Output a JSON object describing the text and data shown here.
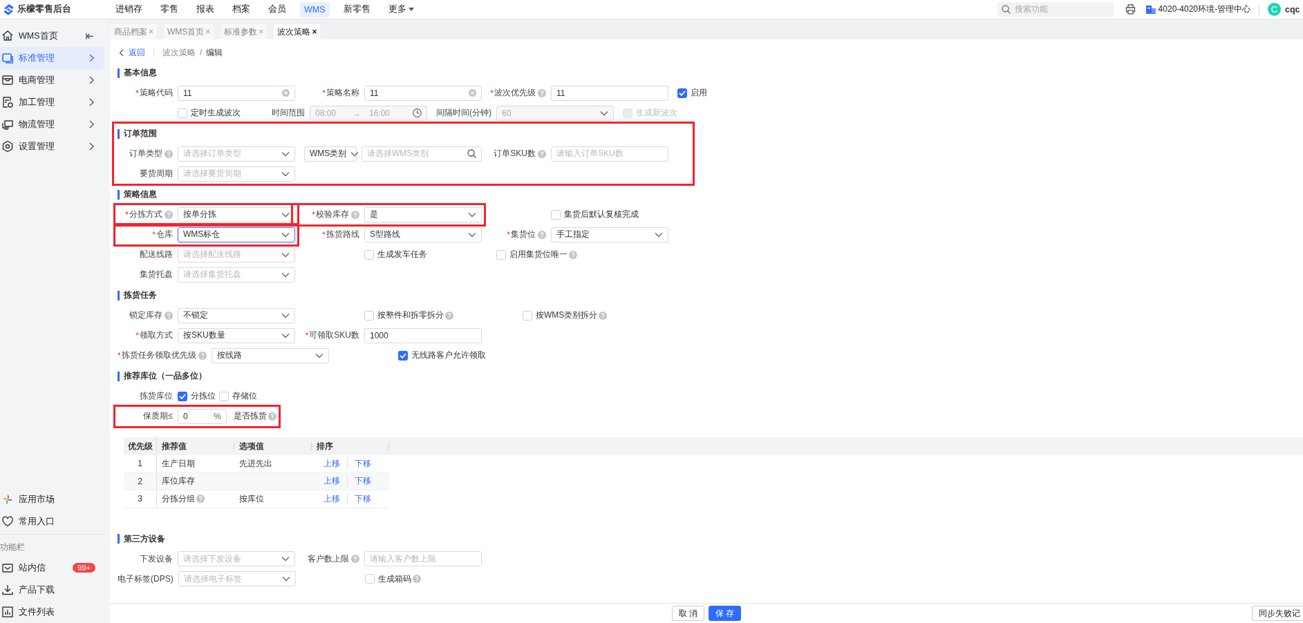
{
  "app": {
    "title": "乐檬零售后台"
  },
  "top_menu": [
    {
      "label": "进销存",
      "selected": false,
      "kind": "link"
    },
    {
      "label": "零售",
      "selected": false,
      "kind": "link"
    },
    {
      "label": "报表",
      "selected": false,
      "kind": "link"
    },
    {
      "label": "档案",
      "selected": false,
      "kind": "link"
    },
    {
      "label": "会员",
      "selected": false,
      "kind": "link"
    },
    {
      "label": "WMS",
      "selected": true,
      "kind": "link"
    },
    {
      "label": "新零售",
      "selected": false,
      "kind": "link"
    },
    {
      "label": "更多",
      "selected": false,
      "kind": "dropdown"
    }
  ],
  "search": {
    "placeholder": "搜索功能"
  },
  "org": "4020-4020环境-管理中心",
  "user": {
    "initial": "C",
    "name": "cqc"
  },
  "sidebar": {
    "items": [
      {
        "label": "WMS首页",
        "selected": false,
        "kind": "collapse"
      },
      {
        "label": "标准管理",
        "selected": true,
        "kind": "submenu"
      },
      {
        "label": "电商管理",
        "selected": false,
        "kind": "submenu"
      },
      {
        "label": "加工管理",
        "selected": false,
        "kind": "submenu"
      },
      {
        "label": "物流管理",
        "selected": false,
        "kind": "submenu"
      },
      {
        "label": "设置管理",
        "selected": false,
        "kind": "submenu"
      }
    ],
    "links": [
      {
        "label": "应用市场"
      },
      {
        "label": "常用入口"
      }
    ],
    "section_title": "功能栏",
    "tools": [
      {
        "label": "站内信",
        "badge": "99+"
      },
      {
        "label": "产品下载"
      },
      {
        "label": "文件列表"
      }
    ]
  },
  "tabs": [
    {
      "label": "商品档案",
      "close": "×",
      "selected": false
    },
    {
      "label": "WMS首页",
      "close": "×",
      "selected": false
    },
    {
      "label": "标准参数",
      "close": "×",
      "selected": false
    },
    {
      "label": "波次策略",
      "close": "×",
      "selected": true
    }
  ],
  "breadcrumb": {
    "back": "返回",
    "path": [
      "波次策略",
      "编辑"
    ],
    "separator": "/"
  },
  "sections": [
    {
      "title": "基本信息",
      "highlighted": false,
      "rows": [
        {
          "items": [
            {
              "kind": "clear_input",
              "star": "*",
              "label": "策略代码",
              "help": false,
              "value": "11"
            },
            {
              "kind": "clear_input",
              "star": "*",
              "label": "策略名称",
              "help": false,
              "value": "11"
            },
            {
              "kind": "input",
              "star": "*",
              "label": "波次优先级",
              "help": true,
              "value": "11"
            },
            {
              "kind": "checkbox",
              "label": "启用",
              "help": false,
              "checked": true
            }
          ]
        },
        {
          "items": [
            {
              "kind": "checkbox",
              "label": "定时生成波次",
              "help": false,
              "checked": false,
              "disabled": false
            },
            {
              "kind": "time_range",
              "label": "时间范围",
              "help": false,
              "start": "08:00",
              "separator": "→",
              "end": "16:00",
              "disabled": true
            },
            {
              "kind": "select",
              "label": "间隔时间(分钟)",
              "help": false,
              "value": "60",
              "disabled": true
            },
            {
              "kind": "checkbox",
              "label": "生成新波次",
              "help": false,
              "checked": false,
              "disabled": true
            }
          ]
        }
      ]
    },
    {
      "title": "订单范围",
      "highlighted": true,
      "rows": [
        {
          "items": [
            {
              "kind": "select",
              "label": "订单类型",
              "help": true,
              "placeholder": "请选择订单类型"
            },
            {
              "kind": "search_select",
              "value": "WMS类别",
              "placeholder": "请选择WMS类别"
            },
            {
              "kind": "input",
              "label": "订单SKU数",
              "help": true,
              "placeholder": "请输入订单SKU数"
            }
          ]
        },
        {
          "items": [
            {
              "kind": "select",
              "label": "要货周期",
              "help": false,
              "placeholder": "请选择要货周期"
            }
          ]
        }
      ]
    },
    {
      "title": "策略信息",
      "highlighted": false,
      "rows": [
        {
          "items": [
            {
              "kind": "select",
              "star": "*",
              "label": "分拣方式",
              "help": true,
              "value": "按单分拣",
              "highlighted": true
            },
            {
              "kind": "select",
              "star": "*",
              "label": "校验库存",
              "help": true,
              "value": "是",
              "highlighted": true
            },
            {
              "kind": "checkbox",
              "label": "集货后默认复核完成",
              "help": false,
              "checked": false,
              "highlighted": false
            }
          ]
        },
        {
          "items": [
            {
              "kind": "select",
              "star": "*",
              "label": "仓库",
              "help": false,
              "value": "WMS标仓",
              "highlighted": true,
              "focused": true
            },
            {
              "kind": "select",
              "star": "*",
              "label": "拣货路线",
              "help": false,
              "value": "S型路线",
              "highlighted": false,
              "focused": false
            },
            {
              "kind": "select",
              "star": "*",
              "label": "集货位",
              "help": true,
              "value": "手工指定",
              "highlighted": false,
              "focused": false
            }
          ]
        },
        {
          "items": [
            {
              "kind": "select",
              "label": "配送线路",
              "help": false,
              "placeholder": "请选择配送线路"
            },
            {
              "kind": "checkbox",
              "label": "生成发车任务",
              "help": false,
              "checked": false
            },
            {
              "kind": "checkbox",
              "label": "启用集货位唯一",
              "help": true,
              "checked": false
            }
          ]
        },
        {
          "items": [
            {
              "kind": "select",
              "label": "集货托盘",
              "help": false,
              "placeholder": "请选择集货托盘"
            }
          ]
        }
      ]
    },
    {
      "title": "拣货任务",
      "highlighted": false,
      "rows": [
        {
          "items": [
            {
              "kind": "select",
              "label": "锁定库存",
              "help": true,
              "value": "不锁定"
            },
            {
              "kind": "checkbox",
              "label": "按整件和拆零拆分",
              "help": true,
              "checked": false
            },
            {
              "kind": "checkbox",
              "label": "按WMS类别拆分",
              "help": true,
              "checked": false
            }
          ]
        },
        {
          "items": [
            {
              "kind": "select",
              "star": "*",
              "label": "领取方式",
              "help": false,
              "value": "按SKU数量"
            },
            {
              "kind": "input",
              "star": "*",
              "label": "可领取SKU数",
              "help": false,
              "value": "1000"
            }
          ]
        },
        {
          "items": [
            {
              "kind": "select",
              "star": "*",
              "label": "拣货任务领取优先级",
              "help": true,
              "value": "按线路"
            },
            {
              "kind": "checkbox",
              "label": "无线路客户允许领取",
              "help": false,
              "checked": true
            }
          ]
        }
      ]
    },
    {
      "title": "推荐库位（一品多位）",
      "highlighted": false,
      "rows": [
        {
          "items": [
            {
              "kind": "check_group",
              "label": "拣货库位",
              "help": false,
              "options": [
                {
                  "label": "分拣位",
                  "checked": true
                },
                {
                  "label": "存储位",
                  "checked": false
                }
              ]
            }
          ]
        },
        {
          "items": [
            {
              "kind": "percent",
              "label": "保质期≤",
              "help": false,
              "value": "0",
              "unit": "%",
              "note": "是否拣货",
              "note_help": true,
              "highlighted": true
            }
          ]
        }
      ],
      "table": {
        "columns": [
          "优先级",
          "推荐值",
          "选项值",
          "排序"
        ],
        "rows": [
          {
            "cells": [
              "1",
              "生产日期",
              "先进先出"
            ],
            "help": false,
            "actions": [
              "上移",
              "下移"
            ]
          },
          {
            "cells": [
              "2",
              "库位库存",
              ""
            ],
            "help": false,
            "actions": [
              "上移",
              "下移"
            ]
          },
          {
            "cells": [
              "3",
              "分拣分组",
              "按库位"
            ],
            "help": true,
            "actions": [
              "上移",
              "下移"
            ]
          }
        ]
      }
    },
    {
      "title": "第三方设备",
      "highlighted": false,
      "rows": [
        {
          "items": [
            {
              "kind": "select",
              "label": "下发设备",
              "help": false,
              "placeholder": "请选择下发设备"
            },
            {
              "kind": "input",
              "label": "客户数上限",
              "help": true,
              "placeholder": "请输入客户数上限"
            }
          ]
        },
        {
          "items": [
            {
              "kind": "select",
              "label": "电子标签(DPS)",
              "help": false,
              "placeholder": "请选择电子标签"
            },
            {
              "kind": "checkbox",
              "label": "生成箱码",
              "help": true,
              "checked": false
            }
          ]
        }
      ]
    }
  ],
  "footer": {
    "buttons": [
      {
        "label": "取 消",
        "kind": "default"
      },
      {
        "label": "保 存",
        "kind": "primary"
      }
    ],
    "side_button": "同步失败记"
  }
}
